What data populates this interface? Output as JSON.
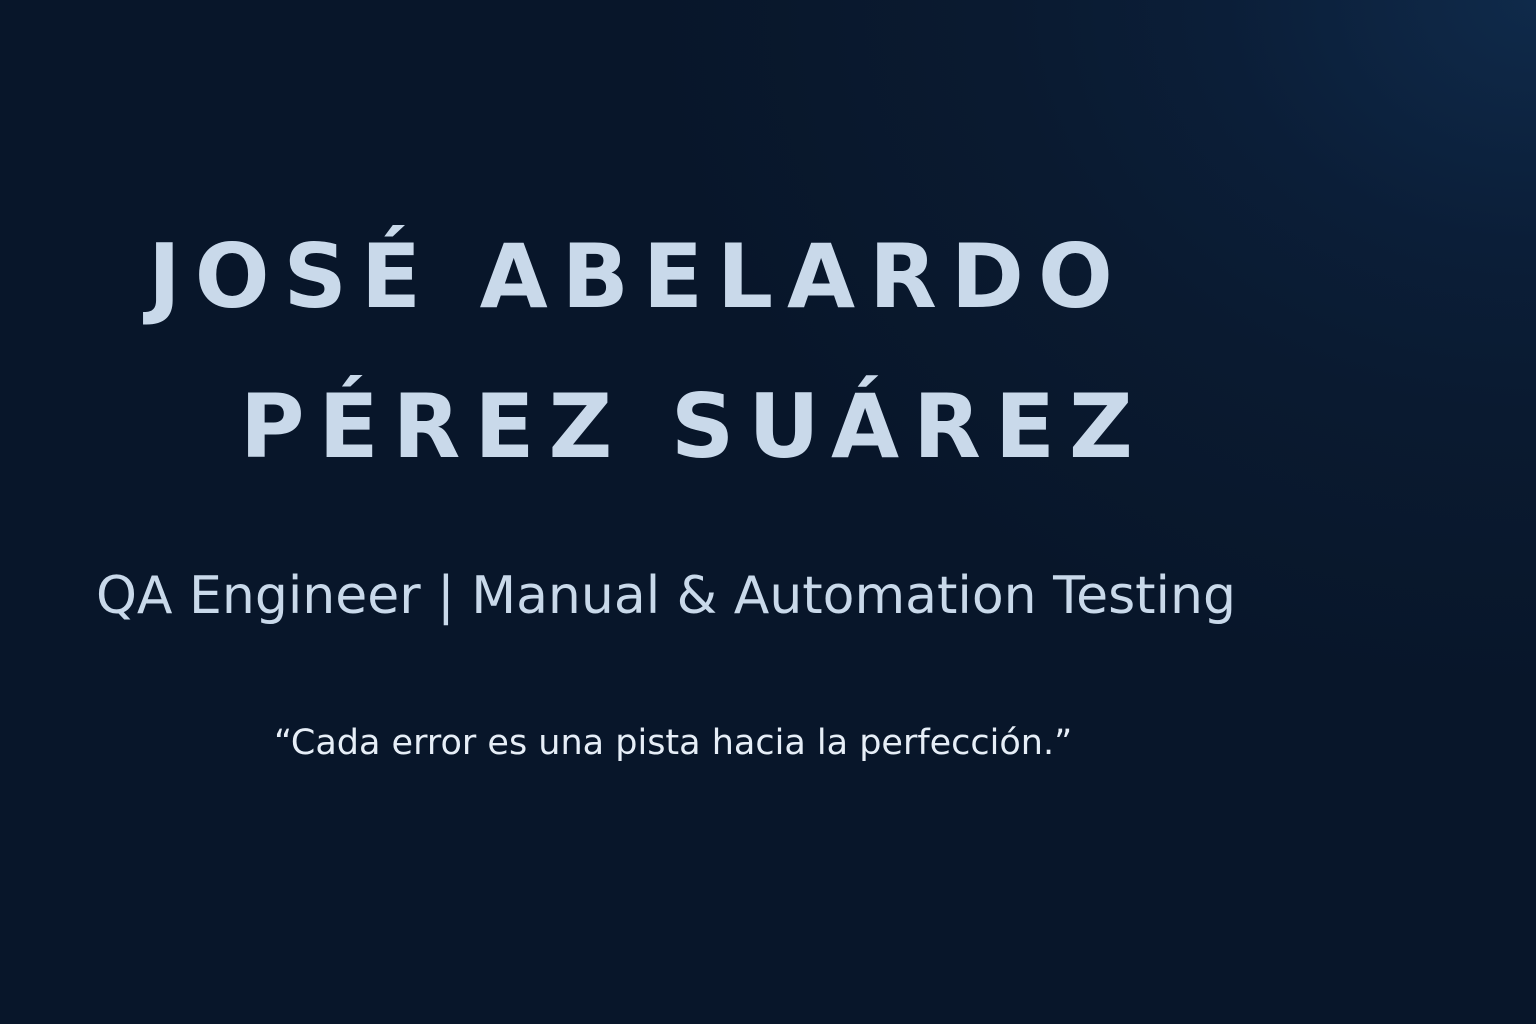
{
  "profile": {
    "name_line_1": "JOSÉ ABELARDO",
    "name_line_2": "PÉREZ SUÁREZ",
    "role": "QA Engineer | Manual & Automation Testing",
    "quote": "“Cada error es una pista hacia la perfección.”"
  },
  "colors": {
    "background": "#0a1a30",
    "background_glow": "#0f2a4a",
    "text_primary": "#c9d9ea",
    "text_quote": "#e6eef7"
  }
}
